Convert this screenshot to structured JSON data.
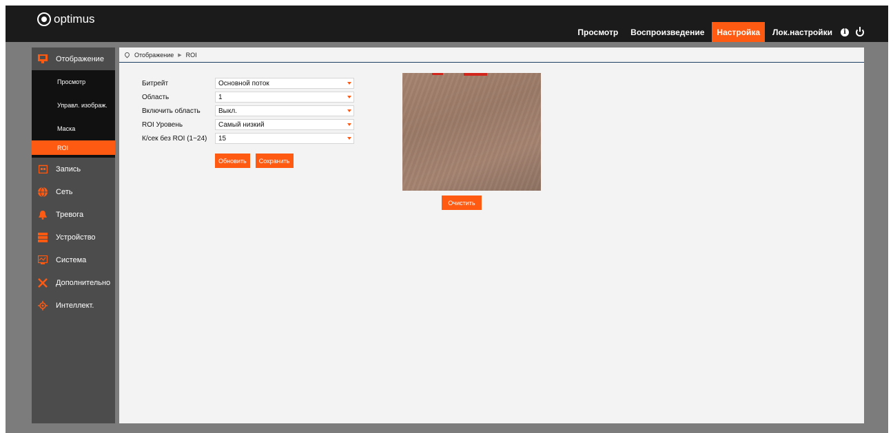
{
  "brand": {
    "name": "optimus"
  },
  "topnav": {
    "items": [
      "Просмотр",
      "Воспроизведение",
      "Настройка",
      "Лок.настройки"
    ],
    "active": "Настройка"
  },
  "sidebar": {
    "display_group": "Отображение",
    "sub_items": [
      "Просмотр",
      "Управл. изображ.",
      "Маска",
      "ROI"
    ],
    "active_sub": "ROI",
    "groups": [
      "Запись",
      "Сеть",
      "Тревога",
      "Устройство",
      "Система",
      "Дополнительно",
      "Интеллект."
    ]
  },
  "breadcrumb": {
    "section": "Отображение",
    "page": "ROI"
  },
  "form": {
    "bitrate": {
      "label": "Битрейт",
      "value": "Основной поток"
    },
    "area": {
      "label": "Область",
      "value": "1"
    },
    "enable": {
      "label": "Включить область",
      "value": "Выкл."
    },
    "level": {
      "label": "ROI Уровень",
      "value": "Самый низкий"
    },
    "fps": {
      "label": "К/сек без ROI (1~24)",
      "value": "15"
    },
    "refresh_label": "Обновить",
    "save_label": "Сохранить"
  },
  "preview": {
    "clear_label": "Очистить"
  },
  "colors": {
    "accent": "#ff5a12",
    "topbar": "#1b1b1b",
    "sidebar": "#4c4c4c",
    "sub_bg": "#111111",
    "frame": "#7c7c7c"
  }
}
